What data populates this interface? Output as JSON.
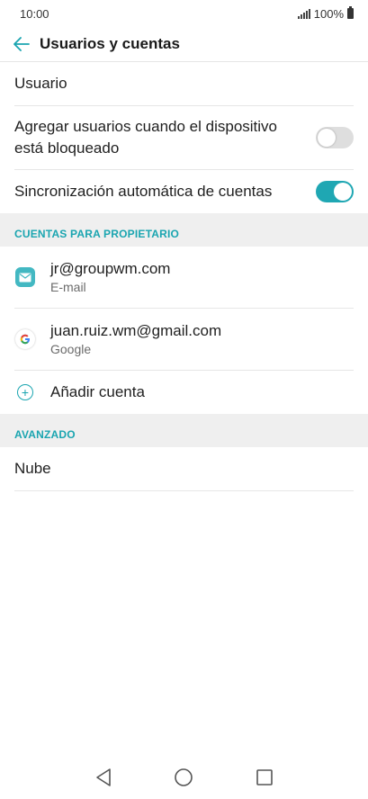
{
  "status_bar": {
    "time": "10:00",
    "battery": "100%"
  },
  "header": {
    "title": "Usuarios y cuentas"
  },
  "settings": {
    "user": "Usuario",
    "add_users_locked": {
      "label": "Agregar usuarios cuando el dispositivo está bloqueado",
      "enabled": false
    },
    "auto_sync": {
      "label": "Sincronización automática de cuentas",
      "enabled": true
    }
  },
  "owner_section": {
    "header": "CUENTAS PARA PROPIETARIO",
    "accounts": [
      {
        "primary": "jr@groupwm.com",
        "secondary": "E-mail",
        "icon": "email-icon"
      },
      {
        "primary": "juan.ruiz.wm@gmail.com",
        "secondary": "Google",
        "icon": "google-icon"
      }
    ],
    "add_account": "Añadir cuenta"
  },
  "advanced_section": {
    "header": "AVANZADO",
    "cloud": "Nube"
  },
  "colors": {
    "accent": "#1aa5b0",
    "toggle_on": "#1fa7b3",
    "section_bg": "#efefef"
  }
}
